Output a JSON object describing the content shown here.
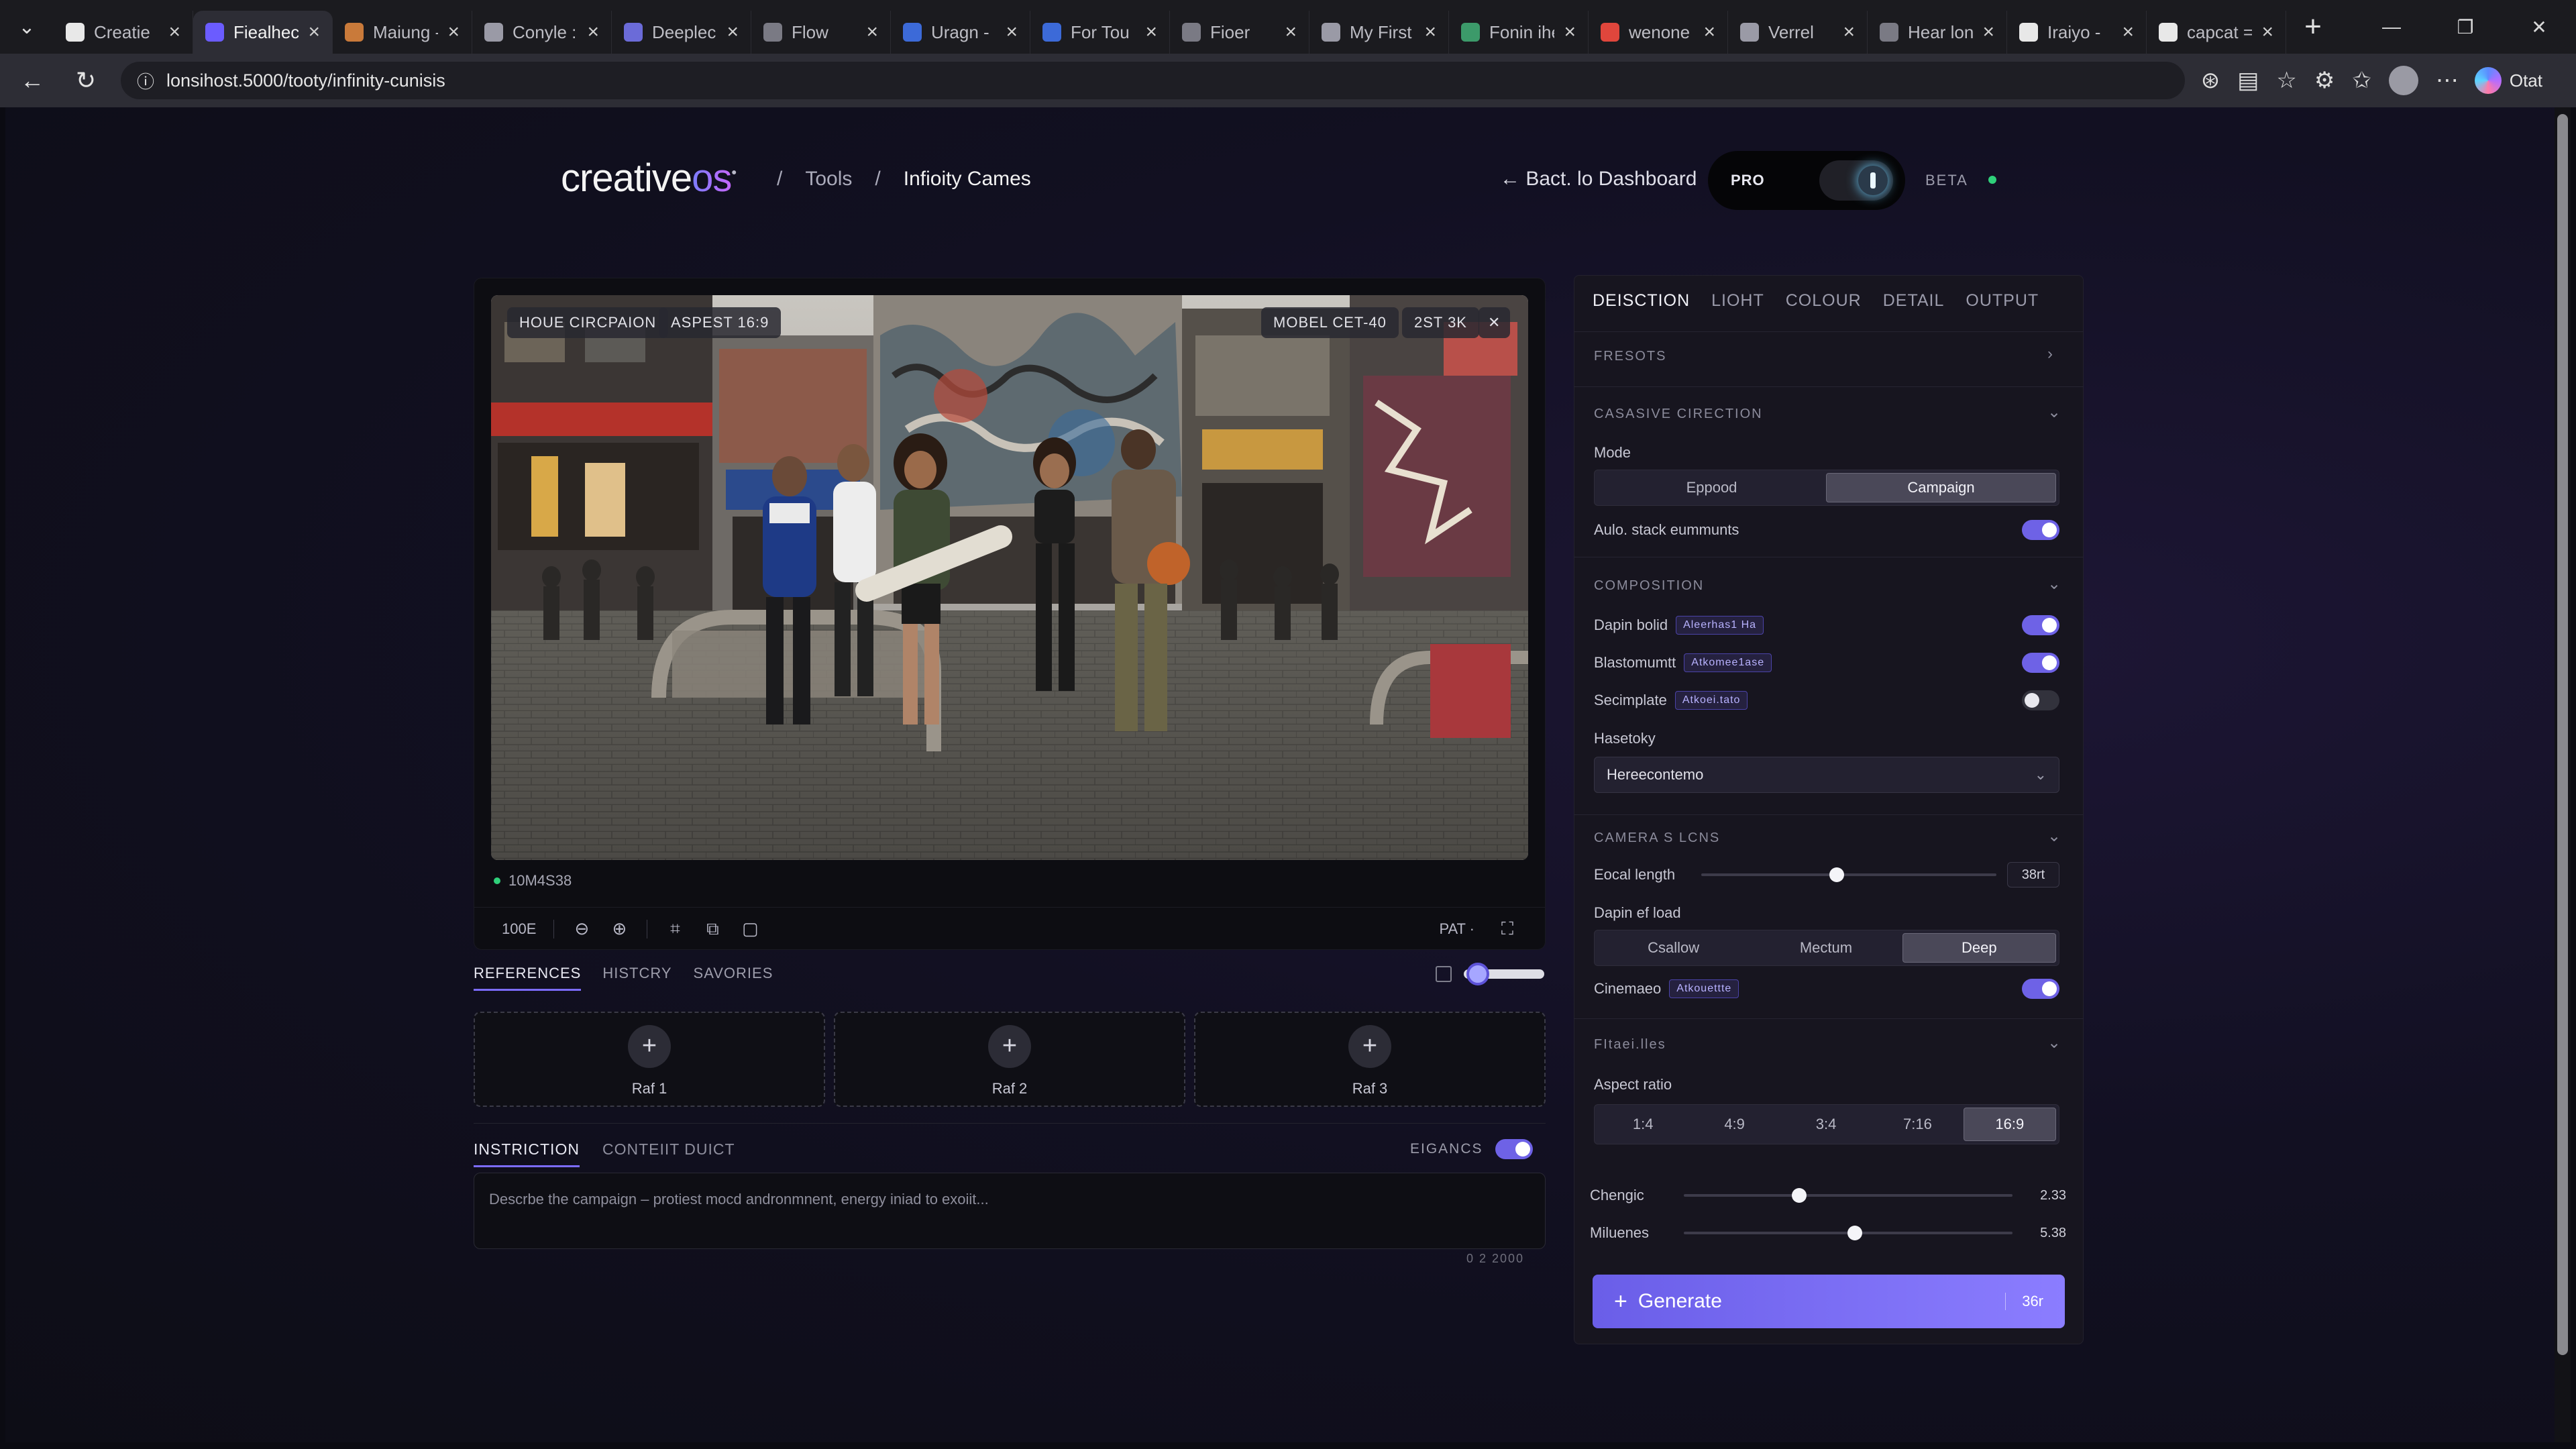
{
  "browser": {
    "tabs": [
      {
        "title": "Creatie",
        "fav": "#e8e8e8",
        "active": false
      },
      {
        "title": "Fiealhec",
        "fav": "#6b5cff",
        "active": true
      },
      {
        "title": "Maiung -",
        "fav": "#c97a3a",
        "active": false
      },
      {
        "title": "Conyle :",
        "fav": "#9a9aa6",
        "active": false
      },
      {
        "title": "Deeplec",
        "fav": "#6b6bd8",
        "active": false
      },
      {
        "title": "Flow",
        "fav": "#7a7a84",
        "active": false
      },
      {
        "title": "Uragn -",
        "fav": "#3c6ad8",
        "active": false
      },
      {
        "title": "For Tou :",
        "fav": "#3c6ad8",
        "active": false
      },
      {
        "title": "Fioer",
        "fav": "#7a7a84",
        "active": false
      },
      {
        "title": "My First",
        "fav": "#9a9aa6",
        "active": false
      },
      {
        "title": "Fonin ihe",
        "fav": "#3c9a6a",
        "active": false
      },
      {
        "title": "wenone",
        "fav": "#e0463c",
        "active": false
      },
      {
        "title": "Verrel",
        "fav": "#9a9aa6",
        "active": false
      },
      {
        "title": "Hear lon",
        "fav": "#7a7a84",
        "active": false
      },
      {
        "title": "Iraiyo -",
        "fav": "#e8e8e8",
        "active": false
      },
      {
        "title": "capcat =",
        "fav": "#e8e8e8",
        "active": false
      }
    ],
    "url": "lonsihost.5000/tooty/infinity-cunisis",
    "copilot_label": "Otat"
  },
  "header": {
    "logo_main": "creative",
    "logo_accent": "os",
    "logo_mark": "•",
    "crumb_sep1": "/",
    "crumb_tools": "Tools",
    "crumb_sep2": "/",
    "crumb_current": "Infioity Cames",
    "back_link": "← Bact. lo Dashboard",
    "mode_label": "PRO",
    "beta_label": "BETA"
  },
  "preview": {
    "chip_mode": "HOUE CIRCPAION",
    "chip_aspect": "ASPEST 16:9",
    "chip_model": "MOBEL CET-40",
    "chip_res": "2ST 3K",
    "chip_close": "✕",
    "status": "10M4S38",
    "toolbar_zoom": "100E",
    "toolbar_fit": "PAT ·",
    "toolbar_fullscreen": "⛶"
  },
  "references": {
    "tabs": [
      "REFERENCES",
      "HISTCRY",
      "SAVORIES"
    ],
    "slots": [
      "Raf 1",
      "Raf 2",
      "Raf 3"
    ]
  },
  "instruction": {
    "tabs": [
      "INSTRICTION",
      "CONTEIIT DUICT"
    ],
    "toggle_label": "EIGANCS",
    "placeholder": "Descrbe the campaign – protiest mocd andronmnent, energy iniad to exoiit...",
    "count": "0 2 2000"
  },
  "panel": {
    "tabs": [
      "DEISCTION",
      "LIOHT",
      "COLOUR",
      "DETAIL",
      "OUTPUT"
    ],
    "presets": "FRESOTS",
    "creative_direction": {
      "title": "CASASIVE CIRECTION",
      "mode_label": "Mode",
      "modes": [
        "Eppood",
        "Campaign"
      ],
      "mode_selected": 1,
      "auto_label": "Aulo. stack eummunts",
      "auto_on": true
    },
    "composition": {
      "title": "COMPOSITION",
      "rows": [
        {
          "label": "Dapin bolid",
          "tag": "Aleerhas1 Ha",
          "on": true
        },
        {
          "label": "Blastomumtt",
          "tag": "Atkomee1ase",
          "on": true
        },
        {
          "label": "Secimplate",
          "tag": "Atkoei.tato",
          "on": false
        }
      ],
      "select_label": "Hasetoky",
      "select_value": "Hereecontemo"
    },
    "camera": {
      "title": "CAMERA S LCNS",
      "focal_label": "Eocal length",
      "focal_value": "38rt",
      "focal_level": 0.46,
      "dof_label": "Dapin ef load",
      "dof_options": [
        "Csallow",
        "Mectum",
        "Deep"
      ],
      "dof_selected": 2,
      "cinematic_label": "Cinemaeo",
      "cinematic_tag": "Atkouettte",
      "cinematic_on": true
    },
    "output": {
      "title": "FItaei.lles",
      "aspect_label": "Aspect ratio",
      "ratios": [
        "1:4",
        "4:9",
        "3:4",
        "7:16",
        "16:9"
      ],
      "ratio_selected": 4,
      "sliders": [
        {
          "label": "Chengic",
          "value": "2.33",
          "level": 0.35
        },
        {
          "label": "Miluenes",
          "value": "5.38",
          "level": 0.52
        }
      ]
    },
    "generate_label": "Generate",
    "generate_cost": "36r"
  }
}
